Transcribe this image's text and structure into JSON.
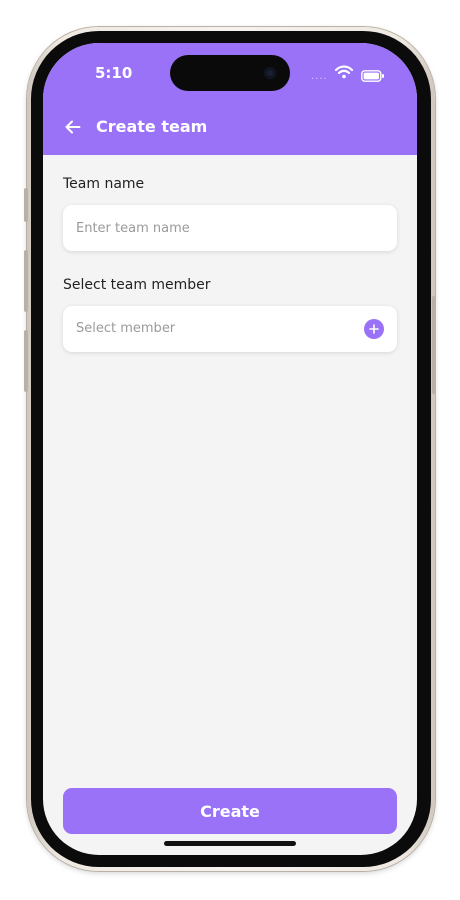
{
  "status_bar": {
    "time": "5:10",
    "signal_dots": "....",
    "wifi_icon": "wifi-icon",
    "battery_icon": "battery-icon"
  },
  "header": {
    "title": "Create team",
    "back_icon": "back-arrow-icon",
    "background_color": "#9a72f8"
  },
  "form": {
    "team_name_label": "Team name",
    "team_name_placeholder": "Enter team name",
    "team_name_value": "",
    "member_label": "Select team member",
    "member_placeholder": "Select member",
    "add_member_icon": "plus-icon"
  },
  "actions": {
    "create_label": "Create"
  },
  "colors": {
    "accent": "#9a72f8",
    "background": "#f4f4f4"
  }
}
